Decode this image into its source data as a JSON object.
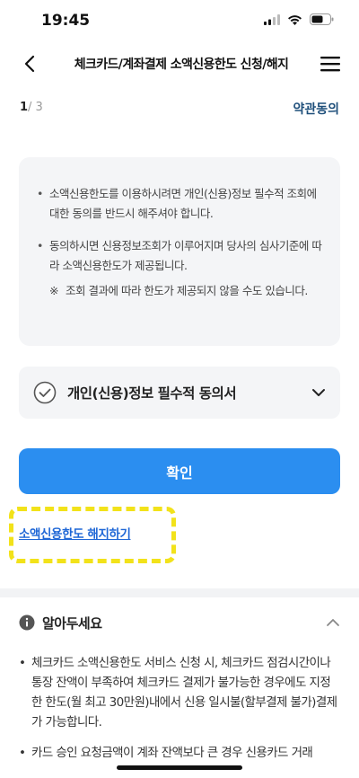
{
  "status_bar": {
    "time": "19:45"
  },
  "nav": {
    "title": "체크카드/계좌결제 소액신용한도 신청/해지"
  },
  "step": {
    "current": "1",
    "total": "/ 3"
  },
  "terms_link": "약관동의",
  "notice": {
    "bullets": [
      "소액신용한도를 이용하시려면 개인(신용)정보 필수적 조회에 대한 동의를 반드시 해주셔야 합니다.",
      "동의하시면 신용정보조회가 이루어지며 당사의 심사기준에 따라 소액신용한도가 제공됩니다."
    ],
    "subnote_mark": "※",
    "subnote": "조회 결과에 따라 한도가 제공되지 않을 수도 있습니다."
  },
  "agreement": {
    "label": "개인(신용)정보 필수적 동의서"
  },
  "confirm_button": "확인",
  "cancel_link": "소액신용한도 해지하기",
  "info": {
    "title": "알아두세요",
    "items": [
      "체크카드 소액신용한도 서비스 신청 시, 체크카드 점검시간이나 통장 잔액이 부족하여 체크카드 결제가 불가능한 경우에도 지정한 한도(월 최고 30만원)내에서 신용 일시불(할부결제 불가)결제가 가능합니다.",
      "카드 승인 요청금액이 계좌 잔액보다 큰 경우 신용카드 거래"
    ]
  },
  "colors": {
    "accent": "#2b8ef0",
    "link": "#1f67d6",
    "highlight": "#f2e21a"
  }
}
